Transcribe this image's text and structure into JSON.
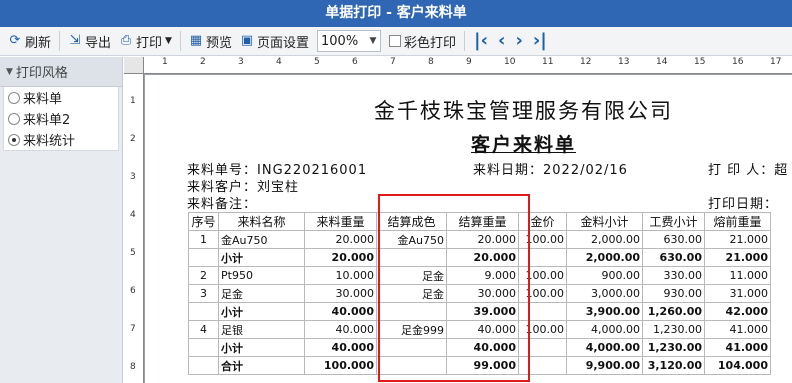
{
  "window": {
    "title": "单据打印 - 客户来料单"
  },
  "toolbar": {
    "refresh": "刷新",
    "export": "导出",
    "print": "打印",
    "preview": "预览",
    "page_setup": "页面设置",
    "zoom": "100%",
    "color_print": "彩色打印"
  },
  "left_panel": {
    "header": "打印风格",
    "styles": [
      {
        "label": "来料单",
        "selected": false
      },
      {
        "label": "来料单2",
        "selected": false
      },
      {
        "label": "来料统计",
        "selected": true
      }
    ]
  },
  "ruler": {
    "h": [
      "1",
      "2",
      "3",
      "4",
      "5",
      "6",
      "7",
      "8",
      "9",
      "10",
      "11",
      "12",
      "13",
      "14",
      "15",
      "16",
      "17"
    ],
    "v": [
      "1",
      "2",
      "3",
      "4",
      "5",
      "6",
      "7",
      "8"
    ]
  },
  "document": {
    "company": "金千枝珠宝管理服务有限公司",
    "title": "客户来料单",
    "order_no_label": "来料单号：",
    "order_no": "ING220216001",
    "date_label": "来料日期：",
    "date": "2022/02/16",
    "printer_label": "打 印 人：",
    "printer": "超",
    "customer_label": "来料客户：",
    "customer": "刘宝柱",
    "note_label": "来料备注：",
    "print_date_label": "打印日期：",
    "columns": [
      "序号",
      "来料名称",
      "来料重量",
      "结算成色",
      "结算重量",
      "金价",
      "金料小计",
      "工费小计",
      "熔前重量"
    ],
    "rows": [
      {
        "type": "item",
        "cells": [
          "1",
          "金Au750",
          "20.000",
          "金Au750",
          "20.000",
          "100.00",
          "2,000.00",
          "630.00",
          "21.000"
        ]
      },
      {
        "type": "sum",
        "cells": [
          "",
          "小计",
          "20.000",
          "",
          "20.000",
          "",
          "2,000.00",
          "630.00",
          "21.000"
        ]
      },
      {
        "type": "item",
        "cells": [
          "2",
          "Pt950",
          "10.000",
          "足金",
          "9.000",
          "100.00",
          "900.00",
          "330.00",
          "11.000"
        ]
      },
      {
        "type": "item",
        "cells": [
          "3",
          "足金",
          "30.000",
          "足金",
          "30.000",
          "100.00",
          "3,000.00",
          "930.00",
          "31.000"
        ]
      },
      {
        "type": "sum",
        "cells": [
          "",
          "小计",
          "40.000",
          "",
          "39.000",
          "",
          "3,900.00",
          "1,260.00",
          "42.000"
        ]
      },
      {
        "type": "item",
        "cells": [
          "4",
          "足银",
          "40.000",
          "足金999",
          "40.000",
          "100.00",
          "4,000.00",
          "1,230.00",
          "41.000"
        ]
      },
      {
        "type": "sum",
        "cells": [
          "",
          "小计",
          "40.000",
          "",
          "40.000",
          "",
          "4,000.00",
          "1,230.00",
          "41.000"
        ]
      },
      {
        "type": "sum",
        "cells": [
          "",
          "合计",
          "100.000",
          "",
          "99.000",
          "",
          "9,900.00",
          "3,120.00",
          "104.000"
        ]
      }
    ]
  }
}
